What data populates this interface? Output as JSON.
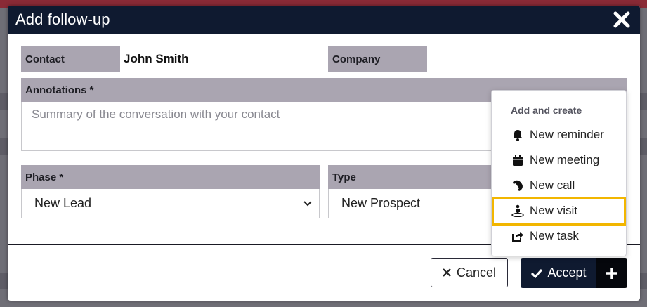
{
  "modal": {
    "title": "Add follow-up",
    "close_icon": "close-icon"
  },
  "form": {
    "contact_label": "Contact",
    "contact_value": "John Smith",
    "company_label": "Company",
    "annotations_label": "Annotations *",
    "annotations_placeholder": "Summary of the conversation with your contact",
    "phase_label": "Phase *",
    "phase_value": "New Lead",
    "type_label": "Type",
    "type_value": "New Prospect"
  },
  "dropdown": {
    "header": "Add and create",
    "items": [
      {
        "label": "New reminder",
        "icon": "bell-icon"
      },
      {
        "label": "New meeting",
        "icon": "calendar-icon"
      },
      {
        "label": "New call",
        "icon": "phone-icon"
      },
      {
        "label": "New visit",
        "icon": "visit-person-icon",
        "highlighted": true
      },
      {
        "label": "New task",
        "icon": "share-task-icon"
      }
    ]
  },
  "footer": {
    "cancel_label": "Cancel",
    "accept_label": "Accept"
  },
  "colors": {
    "header_bg": "#0f1a30",
    "label_bg": "#aaa5b1",
    "highlight": "#f2b600"
  }
}
